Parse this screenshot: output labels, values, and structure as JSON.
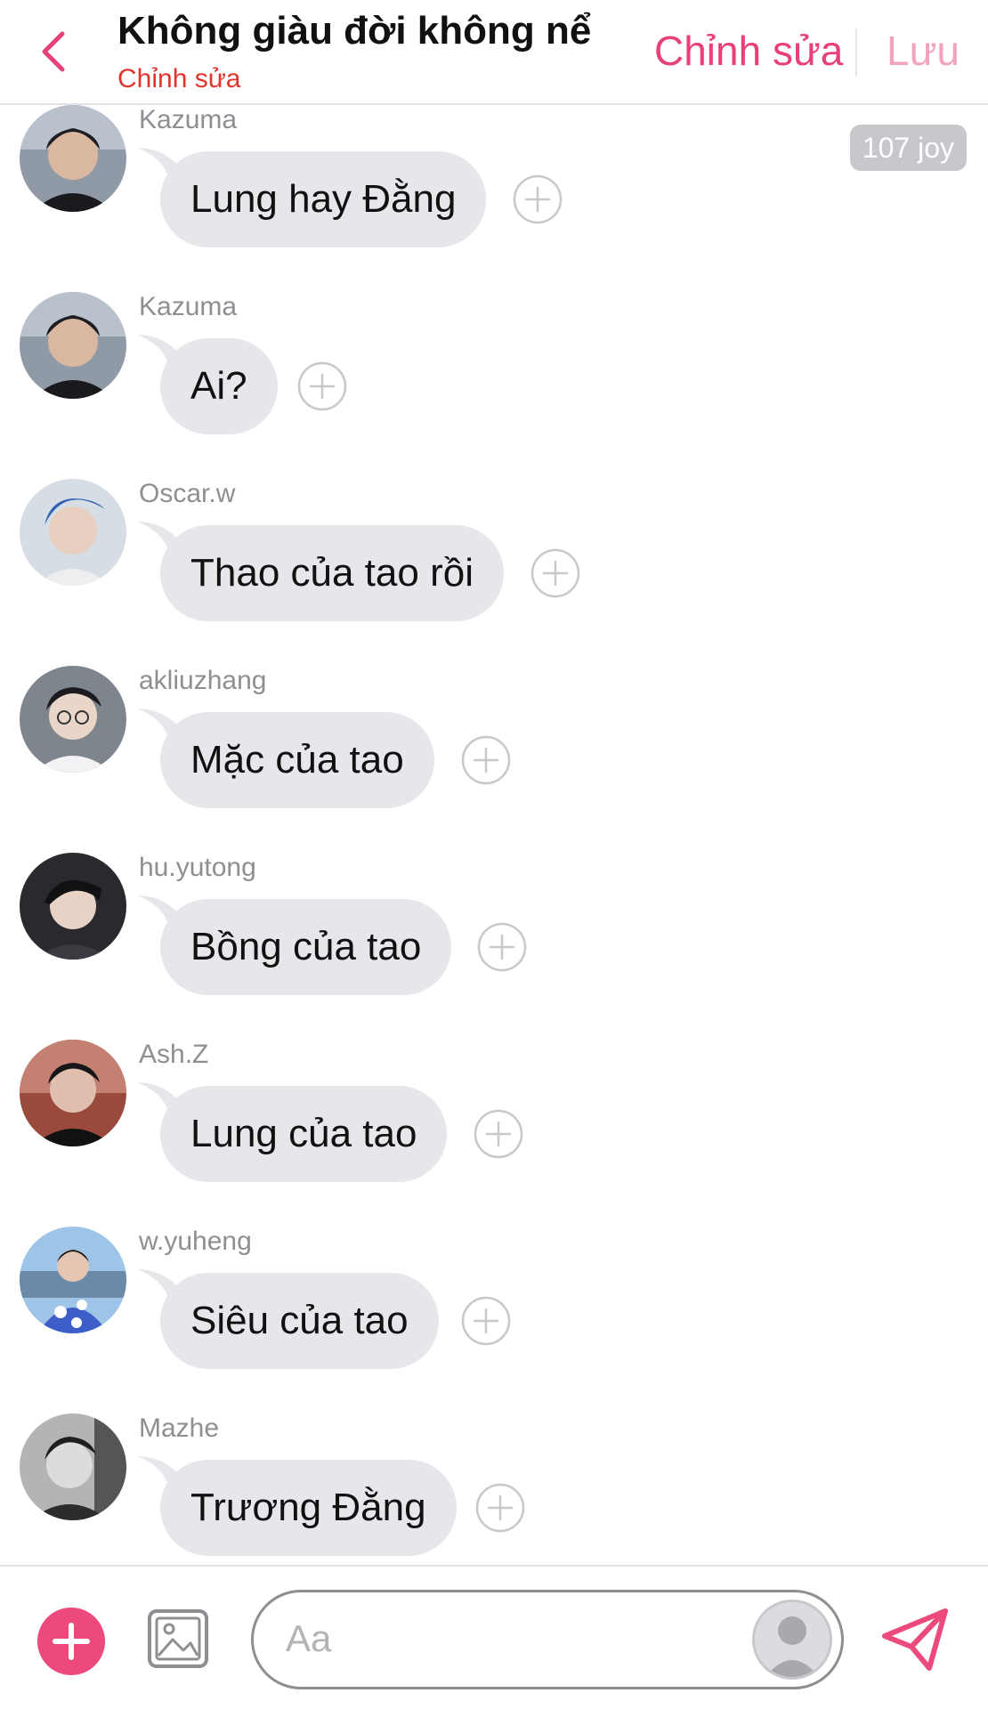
{
  "header": {
    "title": "Không giàu đời không nể",
    "subtitle": "Chỉnh sửa",
    "edit_label": "Chỉnh sửa",
    "save_label": "Lưu"
  },
  "joy_badge": "107 joy",
  "messages": [
    {
      "sender": "Kazuma",
      "text": "Lung hay Đằng"
    },
    {
      "sender": "Kazuma",
      "text": "Ai?"
    },
    {
      "sender": "Oscar.w",
      "text": "Thao của tao rồi"
    },
    {
      "sender": "akliuzhang",
      "text": "Mặc của tao"
    },
    {
      "sender": "hu.yutong",
      "text": "Bồng của tao"
    },
    {
      "sender": "Ash.Z",
      "text": "Lung của tao"
    },
    {
      "sender": "w.yuheng",
      "text": "Siêu của tao"
    },
    {
      "sender": "Mazhe",
      "text": "Trương Đằng"
    }
  ],
  "composer": {
    "placeholder": "Aa"
  },
  "colors": {
    "accent": "#ec4a7c",
    "accent_light": "#f2a3c0",
    "subtitle_red": "#e0352f",
    "bubble": "#e5e7eb"
  },
  "icons": [
    "back-chevron-icon",
    "add-reaction-icon",
    "plus-icon",
    "image-icon",
    "persona-avatar-icon",
    "send-icon"
  ]
}
